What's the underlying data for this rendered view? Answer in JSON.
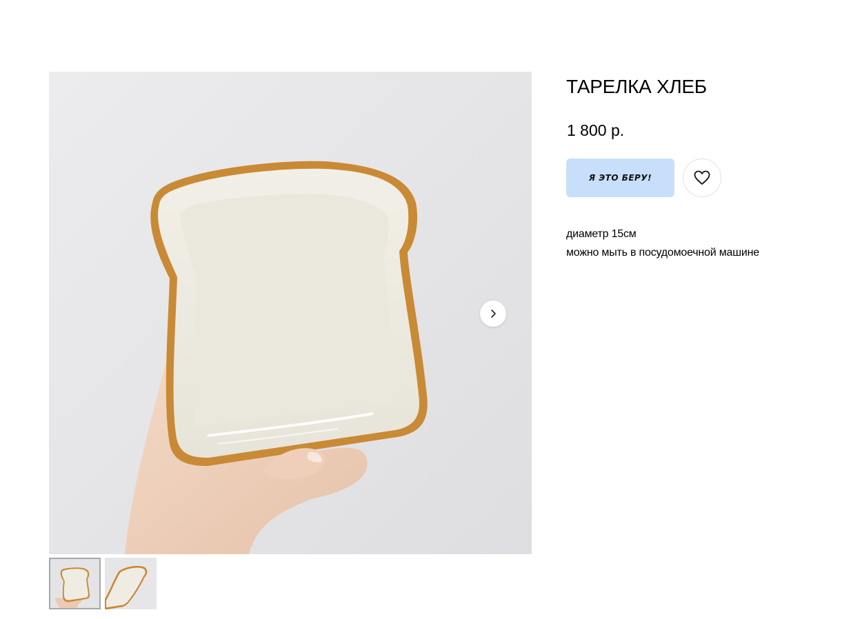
{
  "product": {
    "title": "ТАРЕЛКА ХЛЕБ",
    "price": "1 800 р.",
    "buy_label": "я это беру!",
    "description": [
      "диаметр 15см",
      "можно мыть в посудомоечной машине"
    ]
  },
  "gallery": {
    "next_icon": "chevron-right-icon",
    "favorite_icon": "heart-outline-icon",
    "thumbnail_count": 2,
    "active_thumbnail": 1
  },
  "colors": {
    "buy_button_bg": "#c7dffa",
    "plate_rim": "#c98a35",
    "plate_glaze": "#eeece3",
    "background_wall": "#e6e6e9"
  }
}
